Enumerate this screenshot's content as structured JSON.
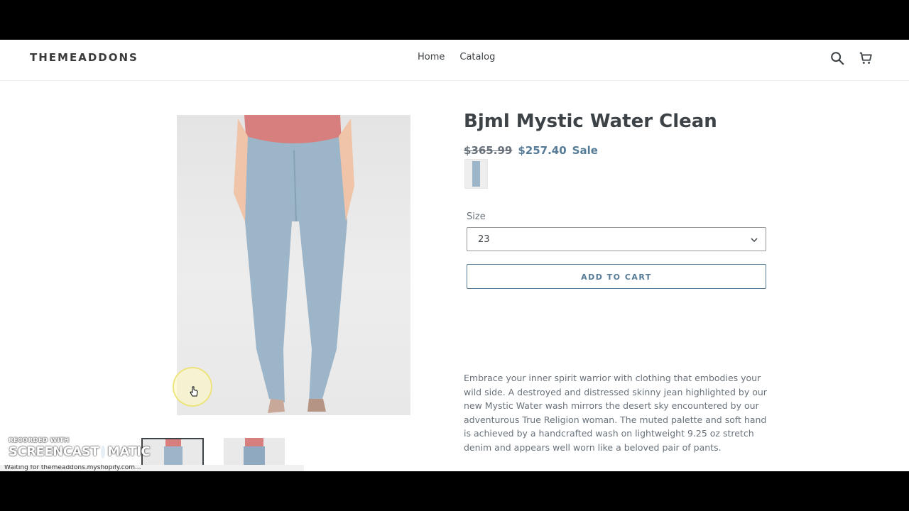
{
  "header": {
    "logo": "THEMEADDONS",
    "nav": [
      "Home",
      "Catalog"
    ],
    "icons": [
      "search-icon",
      "cart-icon"
    ]
  },
  "product": {
    "title": "Bjml Mystic Water Clean",
    "price_old": "$365.99",
    "price_new": "$257.40",
    "sale_label": "Sale",
    "size_label": "Size",
    "size_value": "23",
    "add_to_cart": "ADD TO CART",
    "description": "Embrace your inner spirit warrior with clothing that embodies your wild side. A destroyed and distressed skinny jean highlighted by our new Mystic Water wash mirrors the desert sky encountered by our adventurous True Religion woman. The muted palette and soft hand is achieved by a handcrafted wash on lightweight 9.25 oz stretch denim and appears well worn like a beloved pair of pants."
  },
  "overlay": {
    "recorded_with": "RECORDED WITH",
    "brand_left": "SCREENCAST",
    "brand_right": "MATIC",
    "status_text": "Waiting for themeaddons.myshopify.com..."
  },
  "colors": {
    "accent": "#557b97",
    "text": "#3d4246"
  }
}
